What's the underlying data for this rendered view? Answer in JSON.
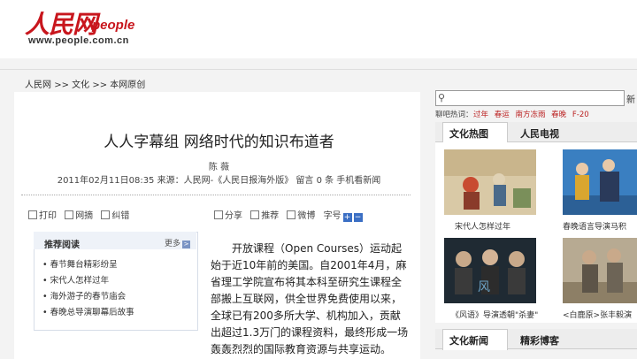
{
  "header": {
    "logo_cn": "人民网",
    "logo_en": "people",
    "logo_url": "www.people.com.cn"
  },
  "breadcrumb": [
    "人民网",
    ">>",
    "文化",
    ">>",
    "本网原创"
  ],
  "article": {
    "title": "人人字幕组 网络时代的知识布道者",
    "author": "陈 薇",
    "meta": "2011年02月11日08:35  来源：人民网-《人民日报海外版》  留言 0 条  手机看新闻",
    "tools_left": [
      "打印",
      "网摘",
      "纠错"
    ],
    "tools_right": [
      "分享",
      "推荐",
      "微博",
      "字号"
    ],
    "body": "开放课程（Open Courses）运动起始于近10年前的美国。自2001年4月，麻省理工学院宣布将其本科至研究生课程全部搬上互联网，供全世界免费使用以来，全球已有200多所大学、机构加入，贡献出超过1.3万门的课程资料，最终形成一场轰轰烈烈的国际教育资源与共享运动。"
  },
  "recommend": {
    "title": "推荐阅读",
    "more": "更多",
    "items": [
      "春节舞台精彩纷呈",
      "宋代人怎样过年",
      "海外游子的春节庙会",
      "春晚总导演聊幕后故事"
    ]
  },
  "sidebar": {
    "search_button": "新",
    "hot_label": "聊吧热词：",
    "hot_words": [
      "过年",
      "春运",
      "南方冻雨",
      "春晚",
      "F-20"
    ],
    "tabs1": [
      "文化热图",
      "人民电视"
    ],
    "thumbs": [
      {
        "caption": "宋代人怎样过年"
      },
      {
        "caption": "春晚语言导演马积"
      },
      {
        "caption": "《风语》导演透朝\"杀妻\""
      },
      {
        "caption": "<白鹿原>张丰毅演"
      }
    ],
    "tabs2": [
      "文化新闻",
      "精彩博客"
    ]
  },
  "colors": {
    "brand_red": "#c8161d",
    "link_blue": "#3b6fc4"
  }
}
